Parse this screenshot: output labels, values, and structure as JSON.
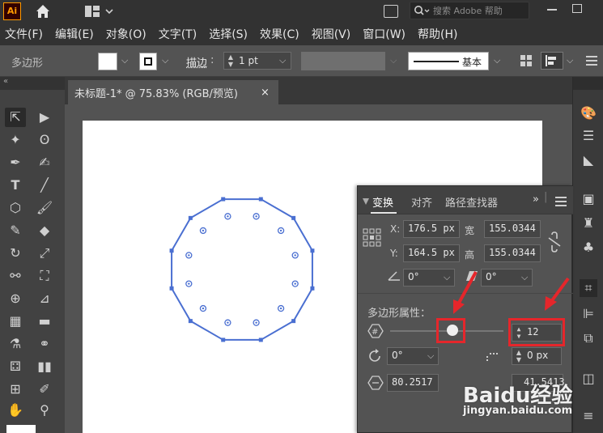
{
  "app": {
    "logo_text": "Ai",
    "search_placeholder": "搜索 Adobe 帮助"
  },
  "menu": [
    "文件(F)",
    "编辑(E)",
    "对象(O)",
    "文字(T)",
    "选择(S)",
    "效果(C)",
    "视图(V)",
    "窗口(W)",
    "帮助(H)"
  ],
  "control": {
    "tool_name": "多边形",
    "stroke_label": "描边",
    "stroke_value": "1 pt",
    "style_label": "基本"
  },
  "document": {
    "tab_title": "未标题-1* @ 75.83% (RGB/预览)",
    "close": "×"
  },
  "transform_panel": {
    "tabs": [
      "变换",
      "对齐",
      "路径查找器"
    ],
    "x_label": "X:",
    "x_value": "176.5 px",
    "y_label": "Y:",
    "y_value": "164.5 px",
    "w_label": "宽",
    "w_value": "155.0344",
    "h_label": "高",
    "h_value": "155.0344",
    "rotate_value": "0°",
    "shear_value": "0°",
    "polygon_props_label": "多边形属性：",
    "sides_value": "12",
    "sides_slider_fraction": 0.55,
    "polygon_rotate_value": "0°",
    "corner_value": "0 px",
    "radius_value": "80.2517",
    "side_length_value": "41.5413"
  },
  "watermark": {
    "brand": "Baidu经验",
    "url": "jingyan.baidu.com"
  },
  "colors": {
    "accent_red": "#e5262b",
    "path_blue": "#4a6fd1"
  }
}
